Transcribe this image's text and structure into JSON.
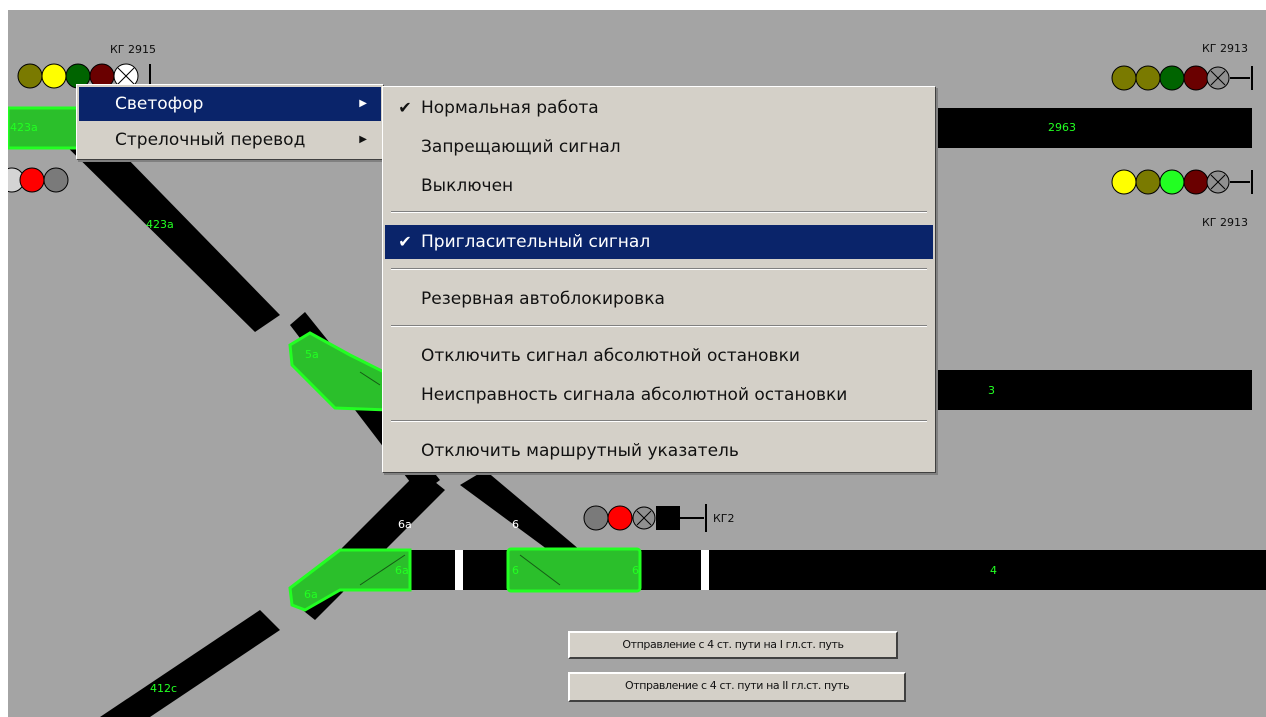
{
  "signals": {
    "kg2915": "КГ 2915",
    "kg2913_top": "КГ 2913",
    "kg2913_bottom": "КГ 2913",
    "kg2": "КГ2"
  },
  "tracks": {
    "t423a_left": "423а",
    "t423a_diag": "423а",
    "t2963": "2963",
    "t5a": "5а",
    "t3": "3",
    "t6a_upper": "6а",
    "t6_upper": "6",
    "t6a_mid": "6а",
    "t6a_left": "6а",
    "t6_green_left": "6",
    "t6_green_right": "6",
    "t4": "4",
    "t412c": "412с"
  },
  "colors": {
    "background": "#a4a4a4",
    "track_black": "#000000",
    "track_green": "#2bbf2b",
    "track_label": "#22ff22",
    "menu_bg": "#d4d0c8",
    "menu_highlight": "#0a246a"
  },
  "context_menu": {
    "items": [
      {
        "label": "Светофор",
        "submenu": true,
        "highlighted": true
      },
      {
        "label": "Стрелочный перевод",
        "submenu": true,
        "highlighted": false
      }
    ]
  },
  "submenu": {
    "items": [
      {
        "label": "Нормальная работа",
        "checked": true
      },
      {
        "label": "Запрещающий сигнал",
        "checked": false
      },
      {
        "label": "Выключен",
        "checked": false
      },
      {
        "label": "Пригласительный сигнал",
        "checked": true,
        "highlighted": true
      },
      {
        "label": "Резервная автоблокировка",
        "checked": false
      },
      {
        "label": "Отключить сигнал абсолютной остановки",
        "checked": false
      },
      {
        "label": "Неисправность сигнала абсолютной остановки",
        "checked": false
      },
      {
        "label": "Отключить маршрутный указатель",
        "checked": false
      }
    ],
    "check_mark": "✔"
  },
  "buttons": {
    "route_1": "Отправление с 4 ст. пути на I гл.ст. путь",
    "route_2": "Отправление с 4 ст. пути на II гл.ст. путь"
  }
}
